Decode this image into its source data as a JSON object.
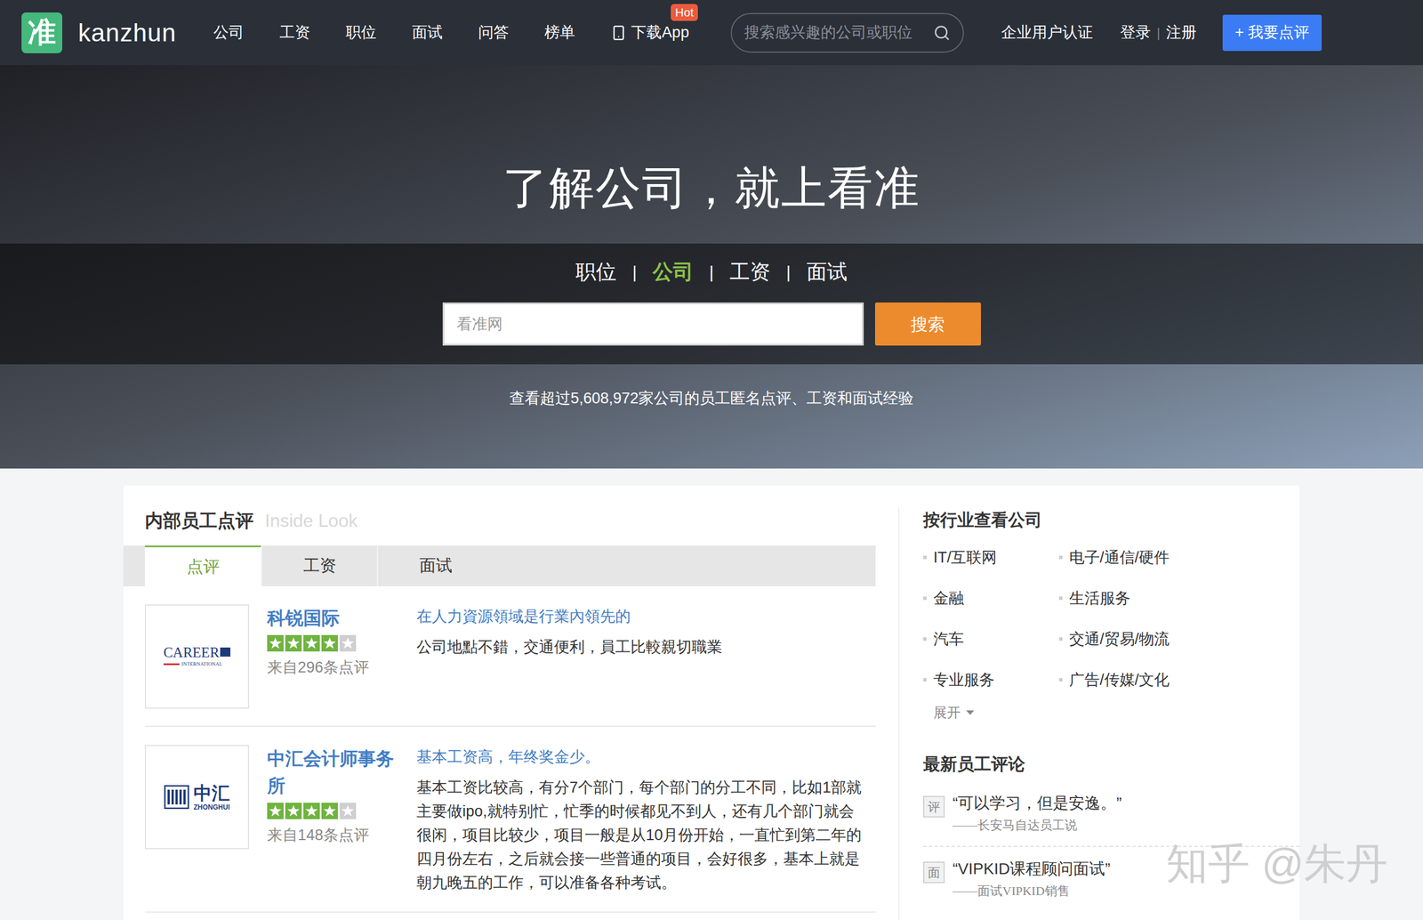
{
  "nav": {
    "logo_mark": "准",
    "logo_text": "kanzhun",
    "items": [
      "公司",
      "工资",
      "职位",
      "面试",
      "问答",
      "榜单"
    ],
    "download": {
      "label": "下载App",
      "badge": "Hot"
    },
    "search": {
      "placeholder": "搜索感兴趣的公司或职位"
    },
    "enterprise": "企业用户认证",
    "login": "登录",
    "divider": "|",
    "register": "注册",
    "cta": "+ 我要点评"
  },
  "hero": {
    "headline": "了解公司，就上看准",
    "tabs": [
      {
        "label": "职位",
        "selected": false
      },
      {
        "label": "公司",
        "selected": true
      },
      {
        "label": "工资",
        "selected": false
      },
      {
        "label": "面试",
        "selected": false
      }
    ],
    "tab_divider": "|",
    "search": {
      "placeholder": "看准网",
      "button": "搜索"
    },
    "stats": "查看超过5,608,972家公司的员工匿名点评、工资和面试经验"
  },
  "inside_look": {
    "title": "内部员工点评",
    "subtitle": "Inside Look",
    "tabs": [
      {
        "label": "点评",
        "selected": true
      },
      {
        "label": "工资",
        "selected": false
      },
      {
        "label": "面试",
        "selected": false
      }
    ],
    "reviews": [
      {
        "company": "科锐国际",
        "logo": {
          "kind": "wordmark",
          "text": "CAREER",
          "subtext": "INTERNATIONAL"
        },
        "stars": 4,
        "count": "来自296条点评",
        "title": "在人力資源領域是行業內領先的",
        "body": "公司地點不錯，交通便利，員工比較親切職業"
      },
      {
        "company": "中汇会计师事务所",
        "logo": {
          "kind": "bars",
          "text": "中汇",
          "subtext": "ZHONGHUI"
        },
        "stars": 4,
        "count": "来自148条点评",
        "title": "基本工资高，年终奖金少。",
        "body": "基本工资比较高，有分7个部门，每个部门的分工不同，比如1部就主要做ipo,就特别忙，忙季的时候都见不到人，还有几个部门就会很闲，项目比较少，项目一般是从10月份开始，一直忙到第二年的四月份左右，之后就会接一些普通的项目，会好很多，基本上就是朝九晚五的工作，可以准备各种考试。"
      }
    ]
  },
  "industries": {
    "title": "按行业查看公司",
    "items": [
      "IT/互联网",
      "电子/通信/硬件",
      "金融",
      "生活服务",
      "汽车",
      "交通/贸易/物流",
      "专业服务",
      "广告/传媒/文化"
    ],
    "expand": "展开",
    "expanded": false
  },
  "latest": {
    "title": "最新员工评论",
    "items": [
      {
        "badge": "评",
        "quote": "“可以学习，但是安逸。”",
        "attribution": "——长安马自达员工说"
      },
      {
        "badge": "面",
        "quote": "“VIPKID课程顾问面试”",
        "attribution": "——面试VIPKID销售"
      }
    ]
  },
  "watermark": "知乎 @朱丹"
}
